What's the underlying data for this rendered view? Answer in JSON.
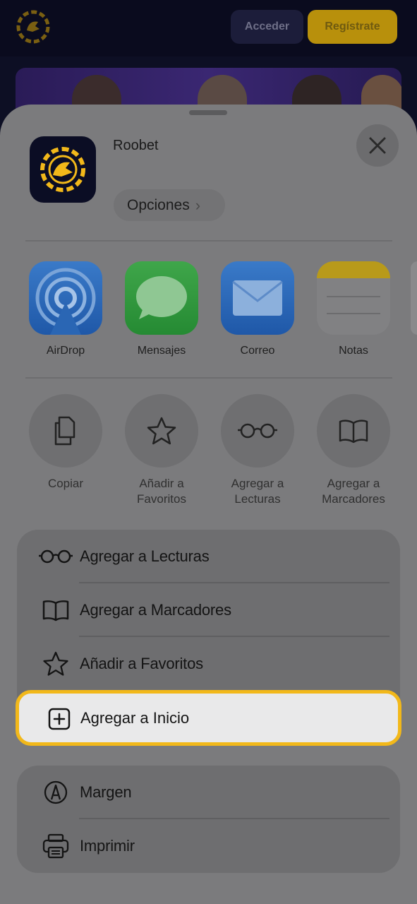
{
  "site": {
    "login_label": "Acceder",
    "register_label": "Regístrate"
  },
  "sheet": {
    "app_name": "Roobet",
    "options_label": "Opciones",
    "apps": [
      {
        "label": "AirDrop",
        "icon": "airdrop-icon"
      },
      {
        "label": "Mensajes",
        "icon": "messages-icon"
      },
      {
        "label": "Correo",
        "icon": "mail-icon"
      },
      {
        "label": "Notas",
        "icon": "notes-icon"
      }
    ],
    "actions": [
      {
        "label_line1": "Copiar",
        "label_line2": "",
        "icon": "copy-icon"
      },
      {
        "label_line1": "Añadir a",
        "label_line2": "Favoritos",
        "icon": "star-icon"
      },
      {
        "label_line1": "Agregar a",
        "label_line2": "Lecturas",
        "icon": "glasses-icon"
      },
      {
        "label_line1": "Agregar a",
        "label_line2": "Marcadores",
        "icon": "book-icon"
      }
    ],
    "list_group_1": [
      {
        "label": "Agregar a Lecturas",
        "icon": "glasses-icon"
      },
      {
        "label": "Agregar a Marcadores",
        "icon": "book-icon"
      },
      {
        "label": "Añadir a Favoritos",
        "icon": "star-icon"
      },
      {
        "label": "Agregar a Inicio",
        "icon": "add-square-icon",
        "highlighted": true
      }
    ],
    "list_group_2": [
      {
        "label": "Margen",
        "icon": "markup-pen-icon"
      },
      {
        "label": "Imprimir",
        "icon": "printer-icon"
      }
    ]
  },
  "colors": {
    "highlight_border": "#f2b81a",
    "brand_gold": "#f2b81a",
    "brand_navy": "#0b0d24"
  }
}
